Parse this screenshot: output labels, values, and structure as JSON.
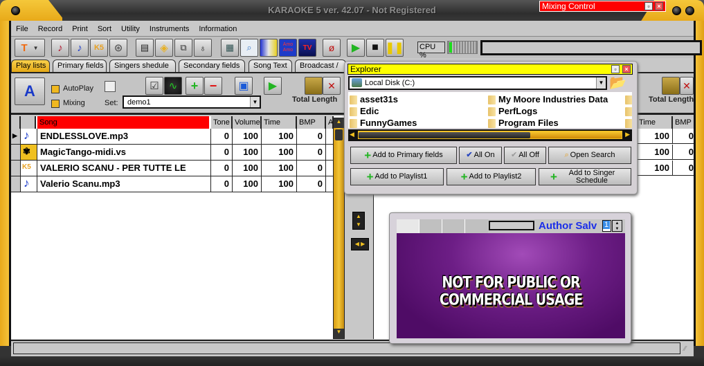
{
  "window": {
    "title": "KARAOKE 5   ver. 42.07 - Not Registered"
  },
  "mixing_control": {
    "title": "Mixing Control"
  },
  "menu": [
    "File",
    "Record",
    "Print",
    "Sort",
    "Utility",
    "Instruments",
    "Information"
  ],
  "toolbar": {
    "icons": [
      "text-tool-icon",
      "red-note-icon",
      "blue-note-icon",
      "k5-icon",
      "film-reel-icon",
      "export-icon",
      "open-folder-icon",
      "document-search-icon",
      "microphone-icon",
      "mixer-icon",
      "picture-search-icon",
      "equalizer-icon",
      "amo-amo-icon",
      "tv-icon",
      "ghost-icon",
      "play-icon",
      "stop-icon",
      "pause-icon"
    ],
    "cpu_label": "CPU %",
    "cpu_percent": 10
  },
  "tabs": [
    {
      "label": "Play lists",
      "active": true
    },
    {
      "label": "Primary fields",
      "active": false
    },
    {
      "label": "Singers shedule",
      "active": false
    },
    {
      "label": "Secondary fields",
      "active": false
    },
    {
      "label": "Song Text",
      "active": false
    },
    {
      "label": "Broadcast /",
      "active": false
    }
  ],
  "playlist_panel": {
    "autoplay_label": "AutoPlay",
    "mixing_label": "Mixing",
    "set_label": "Set:",
    "set_value": "demo1",
    "total_length_label": "Total Length"
  },
  "grid": {
    "columns": [
      "Song",
      "Tone",
      "Volume",
      "Time",
      "BMP",
      "A"
    ],
    "rows": [
      {
        "icon": "mp3-note-icon",
        "song": "ENDLESSLOVE.mp3",
        "tone": "0",
        "volume": "100",
        "time": "100",
        "bmp": "0"
      },
      {
        "icon": "midi-vs-icon",
        "song": "MagicTango-midi.vs",
        "tone": "0",
        "volume": "100",
        "time": "100",
        "bmp": "0"
      },
      {
        "icon": "k5-icon",
        "song": "VALERIO SCANU - PER TUTTE LE",
        "tone": "0",
        "volume": "100",
        "time": "100",
        "bmp": "0"
      },
      {
        "icon": "mp3-note-icon",
        "song": "Valerio Scanu.mp3",
        "tone": "0",
        "volume": "100",
        "time": "100",
        "bmp": "0"
      }
    ]
  },
  "right_grid": {
    "columns": [
      "Time",
      "BMP"
    ],
    "rows": [
      {
        "time": "100",
        "bmp": "0"
      },
      {
        "time": "100",
        "bmp": "0"
      },
      {
        "time": "100",
        "bmp": "0"
      }
    ],
    "total_length_label": "Total Length"
  },
  "explorer": {
    "title": "Explorer",
    "drive": "Local Disk (C:)",
    "folders_col1": [
      "asset31s",
      "Edic",
      "FunnyGames"
    ],
    "folders_col2": [
      "My Moore Industries Data",
      "PerfLogs",
      "Program Files"
    ],
    "buttons": {
      "add_primary": "Add to Primary fields",
      "all_on": "All On",
      "all_off": "All Off",
      "open_search": "Open Search",
      "add_playlist1": "Add to Playlist1",
      "add_playlist2": "Add to Playlist2",
      "add_singer": "Add to Singer Schedule"
    }
  },
  "video": {
    "author_label": "Author Salv",
    "spin_value": "1",
    "overlay_text": "NOT FOR PUBLIC OR COMMERCIAL USAGE"
  }
}
